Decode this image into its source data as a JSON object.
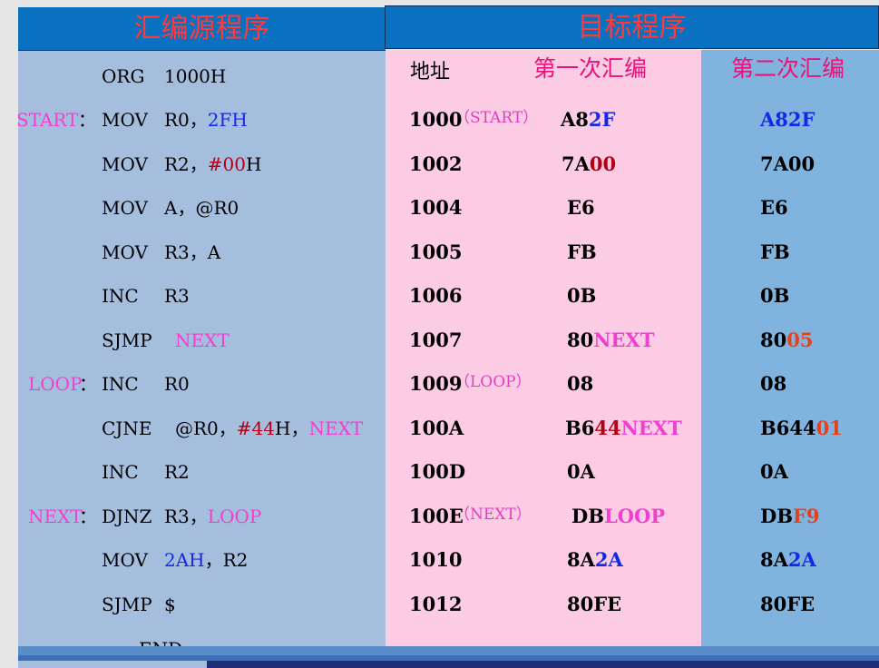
{
  "header": {
    "left_title": "汇编源程序",
    "right_title": "目标程序"
  },
  "columns": {
    "address": "地址",
    "first_pass": "第一次汇编",
    "second_pass": "第二次汇编"
  },
  "source": {
    "org": "ORG",
    "org_arg": "1000H",
    "rows": [
      {
        "label": "START",
        "sep": "：",
        "op": "MOV",
        "args": [
          [
            "R0，",
            ""
          ],
          [
            "2FH",
            "blue"
          ]
        ]
      },
      {
        "label": "",
        "sep": "",
        "op": "MOV",
        "args": [
          [
            "R2，",
            ""
          ],
          [
            "#00",
            "red"
          ],
          [
            "H",
            ""
          ]
        ]
      },
      {
        "label": "",
        "sep": "",
        "op": "MOV",
        "args": [
          [
            "A，@R0",
            ""
          ]
        ]
      },
      {
        "label": "",
        "sep": "",
        "op": "MOV",
        "args": [
          [
            "R3，A",
            ""
          ]
        ]
      },
      {
        "label": "",
        "sep": "",
        "op": "INC",
        "args": [
          [
            "R3",
            ""
          ]
        ]
      },
      {
        "label": "",
        "sep": "",
        "op": "SJMP",
        "args": [
          [
            "NEXT",
            "pink"
          ]
        ]
      },
      {
        "label": "LOOP",
        "sep": "：",
        "op": "INC",
        "args": [
          [
            "R0",
            ""
          ]
        ]
      },
      {
        "label": "",
        "sep": "",
        "op": "CJNE",
        "args": [
          [
            "@R0，",
            ""
          ],
          [
            "#44",
            "red"
          ],
          [
            "H，",
            ""
          ],
          [
            "NEXT",
            "pink"
          ]
        ]
      },
      {
        "label": "",
        "sep": "",
        "op": "INC",
        "args": [
          [
            "R2",
            ""
          ]
        ]
      },
      {
        "label": "NEXT",
        "sep": "：",
        "op": "DJNZ",
        "args": [
          [
            "R3，",
            ""
          ],
          [
            "LOOP",
            "pink"
          ]
        ]
      },
      {
        "label": "",
        "sep": "",
        "op": "MOV",
        "args": [
          [
            "2AH",
            "blue"
          ],
          [
            "，R2",
            ""
          ]
        ]
      },
      {
        "label": "",
        "sep": "",
        "op": "SJMP",
        "args": [
          [
            "$",
            ""
          ]
        ]
      }
    ],
    "end": "END"
  },
  "object": {
    "rows": [
      {
        "addr": "1000",
        "tag": "（START）",
        "first": [
          [
            "A8",
            ""
          ],
          [
            "2F",
            "blue"
          ]
        ],
        "second": [
          [
            "A82F",
            "blue"
          ]
        ]
      },
      {
        "addr": "1002",
        "tag": "",
        "first": [
          [
            "7A",
            ""
          ],
          [
            "00",
            "red"
          ]
        ],
        "second": [
          [
            "7A00",
            ""
          ]
        ]
      },
      {
        "addr": "1004",
        "tag": "",
        "first": [
          [
            "E6",
            ""
          ]
        ],
        "second": [
          [
            "E6",
            ""
          ]
        ]
      },
      {
        "addr": "1005",
        "tag": "",
        "first": [
          [
            "FB",
            ""
          ]
        ],
        "second": [
          [
            "FB",
            ""
          ]
        ]
      },
      {
        "addr": "1006",
        "tag": "",
        "first": [
          [
            "0B",
            ""
          ]
        ],
        "second": [
          [
            "0B",
            ""
          ]
        ]
      },
      {
        "addr": "1007",
        "tag": "",
        "first": [
          [
            "80",
            ""
          ],
          [
            "NEXT",
            "pink"
          ]
        ],
        "second": [
          [
            "80",
            ""
          ],
          [
            "05",
            "orng"
          ]
        ]
      },
      {
        "addr": "1009",
        "tag": "（LOOP）",
        "first": [
          [
            "08",
            ""
          ]
        ],
        "second": [
          [
            "08",
            ""
          ]
        ]
      },
      {
        "addr": "100A",
        "tag": "",
        "first": [
          [
            "B6",
            ""
          ],
          [
            "44",
            "red"
          ],
          [
            "NEXT",
            "pink"
          ]
        ],
        "second": [
          [
            "B644",
            ""
          ],
          [
            "01",
            "orng"
          ]
        ]
      },
      {
        "addr": "100D",
        "tag": "",
        "first": [
          [
            "0A",
            ""
          ]
        ],
        "second": [
          [
            "0A",
            ""
          ]
        ]
      },
      {
        "addr": "100E",
        "tag": "（NEXT）",
        "first": [
          [
            "DB",
            ""
          ],
          [
            "LOOP",
            "pink"
          ]
        ],
        "second": [
          [
            "DB",
            ""
          ],
          [
            "F9",
            "orng"
          ]
        ]
      },
      {
        "addr": "1010",
        "tag": "",
        "first": [
          [
            "8A",
            ""
          ],
          [
            "2A",
            "blue"
          ]
        ],
        "second": [
          [
            "8A",
            ""
          ],
          [
            "2A",
            "blue"
          ]
        ]
      },
      {
        "addr": "1012",
        "tag": "",
        "first": [
          [
            "80FE",
            ""
          ]
        ],
        "second": [
          [
            "80FE",
            ""
          ]
        ]
      }
    ]
  }
}
